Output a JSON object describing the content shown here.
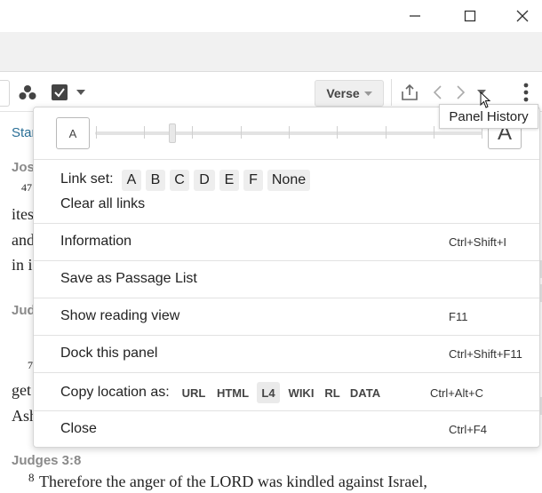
{
  "toolbar": {
    "verse_label": "Verse"
  },
  "background": {
    "tab_link": "Star",
    "refs": [
      "Jos",
      "Jud",
      "Judges 3:8"
    ],
    "verse_numbers": [
      "47",
      "7",
      "8"
    ],
    "lines": [
      "ites",
      "and",
      "in i",
      "get",
      "Ash"
    ],
    "last_line": "Therefore the anger of the LORD was kindled against Israel,"
  },
  "menu": {
    "font_small": "A",
    "font_large": "A",
    "link_set_label": "Link set:",
    "link_set_options": [
      "A",
      "B",
      "C",
      "D",
      "E",
      "F",
      "None"
    ],
    "clear_links": "Clear all links",
    "information": "Information",
    "information_shortcut": "Ctrl+Shift+I",
    "save_passage": "Save as Passage List",
    "reading_view": "Show reading view",
    "reading_view_shortcut": "F11",
    "dock_panel": "Dock this panel",
    "dock_panel_shortcut": "Ctrl+Shift+F11",
    "copy_location_label": "Copy location as:",
    "copy_formats": [
      "URL",
      "HTML",
      "L4",
      "WIKI",
      "RL",
      "DATA"
    ],
    "copy_location_shortcut": "Ctrl+Alt+C",
    "close": "Close",
    "close_shortcut": "Ctrl+F4"
  },
  "tooltip": "Panel History"
}
